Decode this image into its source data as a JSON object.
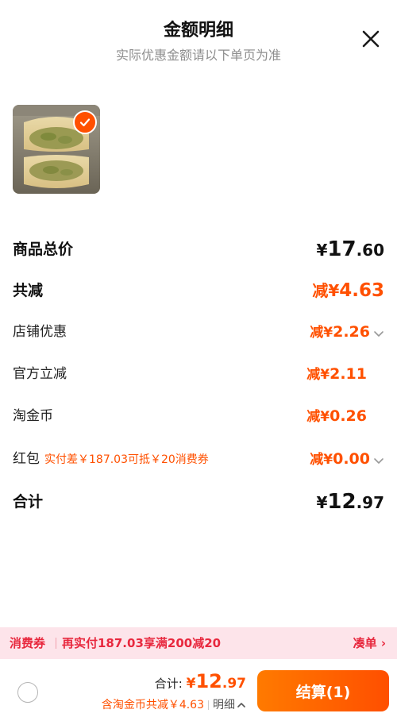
{
  "header": {
    "title": "金额明细",
    "subtitle": "实际优惠金额请以下单页为准"
  },
  "product": {
    "thumbnail_icon": "mooncake-image",
    "selected": true
  },
  "rows": {
    "goods_total": {
      "label": "商品总价",
      "currency": "¥",
      "int": "17",
      "dec": ".60"
    },
    "total_discount": {
      "label": "共减",
      "prefix": "减¥",
      "amount": "4.63"
    },
    "shop_discount": {
      "label": "店铺优惠",
      "prefix": "减¥",
      "amount": "2.26"
    },
    "official_discount": {
      "label": "官方立减",
      "prefix": "减¥",
      "amount": "2.11"
    },
    "taojinbi": {
      "label": "淘金币",
      "prefix": "减¥",
      "amount": "0.26"
    },
    "red_packet": {
      "label": "红包",
      "hint": "实付差￥187.03可抵￥20消费券",
      "prefix": "减¥",
      "amount": "0.00"
    },
    "sum": {
      "label": "合计",
      "currency": "¥",
      "int": "12",
      "dec": ".97"
    }
  },
  "promo": {
    "tag": "消费券",
    "text": "再实付187.03享满200减20",
    "link": "凑单 ›"
  },
  "footer": {
    "total_label": "合计: ",
    "currency": "¥",
    "int": "12",
    "dec": ".97",
    "sub_text": "含淘金币共减￥4.63",
    "detail_label": "明细",
    "checkout_label": "结算(1)"
  },
  "colors": {
    "accent": "#ff5000",
    "promo_bg": "#fde4ea",
    "promo_text": "#e8283e"
  }
}
